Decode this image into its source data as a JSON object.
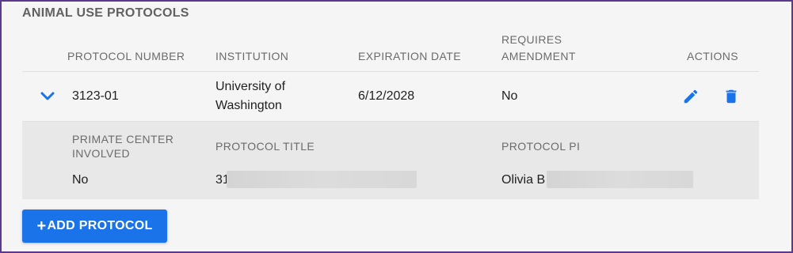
{
  "section": {
    "title": "ANIMAL USE PROTOCOLS"
  },
  "table": {
    "headers": {
      "protocol_number": "PROTOCOL NUMBER",
      "institution": "INSTITUTION",
      "expiration_date": "EXPIRATION DATE",
      "requires_amendment_1": "REQUIRES",
      "requires_amendment_2": "AMENDMENT",
      "actions": "ACTIONS"
    },
    "rows": [
      {
        "protocol_number": "3123-01",
        "institution_1": "University of",
        "institution_2": "Washington",
        "expiration_date": "6/12/2028",
        "requires_amendment": "No"
      }
    ]
  },
  "details": {
    "primate_center_label_1": "PRIMATE CENTER",
    "primate_center_label_2": "INVOLVED",
    "primate_center_value": "No",
    "protocol_title_label": "PROTOCOL TITLE",
    "protocol_title_value": "31",
    "protocol_pi_label": "PROTOCOL PI",
    "protocol_pi_value": "Olivia B"
  },
  "buttons": {
    "add_protocol": "ADD PROTOCOL",
    "add_icon": "+"
  },
  "icons": {
    "expand": "chevron-down-icon",
    "edit": "pencil-icon",
    "delete": "trash-icon"
  },
  "colors": {
    "accent": "#1a73e8",
    "frame": "#5b3a8e"
  }
}
